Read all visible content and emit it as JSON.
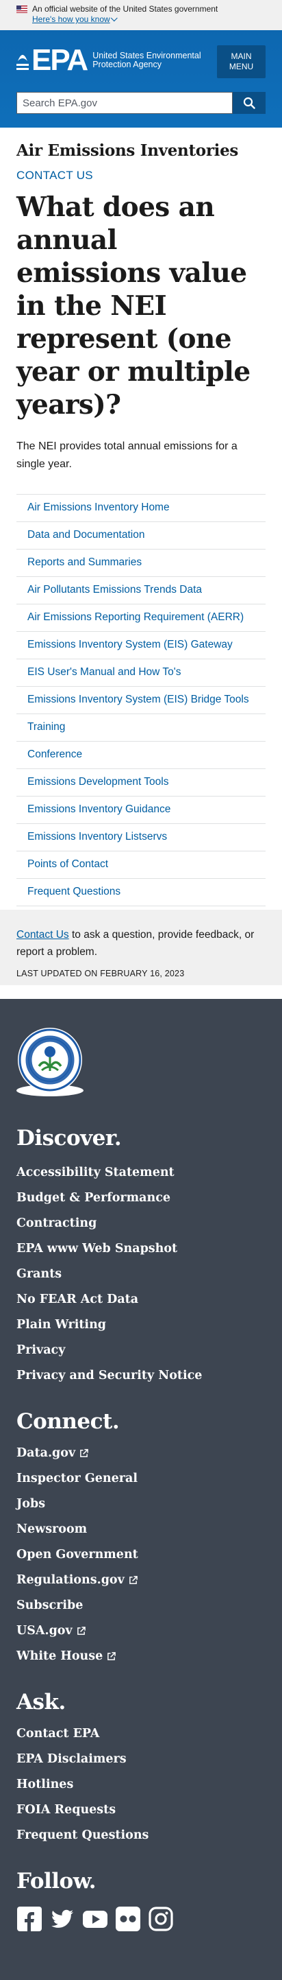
{
  "gov_banner": {
    "text": "An official website of the United States government",
    "how_link": "Here's how you know"
  },
  "header": {
    "logo_mark": "EPA",
    "logo_text": "United States Environmental Protection Agency",
    "menu_line1": "MAIN",
    "menu_line2": "MENU",
    "search_placeholder": "Search EPA.gov"
  },
  "main": {
    "section_title": "Air Emissions Inventories",
    "contact_link": "CONTACT US",
    "page_title": "What does an annual emissions value in the NEI represent (one year or multiple years)?",
    "intro": "The NEI provides total annual emissions for a single year.",
    "sidenav": [
      "Air Emissions Inventory Home",
      "Data and Documentation",
      "Reports and Summaries",
      "Air Pollutants Emissions Trends Data",
      "Air Emissions Reporting Requirement (AERR)",
      "Emissions Inventory System (EIS) Gateway",
      "EIS User's Manual and How To's",
      "Emissions Inventory System (EIS) Bridge Tools",
      "Training",
      "Conference",
      "Emissions Development Tools",
      "Emissions Inventory Guidance",
      "Emissions Inventory Listservs",
      "Points of Contact",
      "Frequent Questions"
    ]
  },
  "contact_strip": {
    "link": "Contact Us",
    "text": " to ask a question, provide feedback, or report a problem.",
    "updated": "LAST UPDATED ON FEBRUARY 16, 2023"
  },
  "footer": {
    "discover_heading": "Discover.",
    "discover": [
      {
        "label": "Accessibility Statement",
        "ext": false
      },
      {
        "label": "Budget & Performance",
        "ext": false
      },
      {
        "label": "Contracting",
        "ext": false
      },
      {
        "label": "EPA www Web Snapshot",
        "ext": false
      },
      {
        "label": "Grants",
        "ext": false
      },
      {
        "label": "No FEAR Act Data",
        "ext": false
      },
      {
        "label": "Plain Writing",
        "ext": false
      },
      {
        "label": "Privacy",
        "ext": false
      },
      {
        "label": "Privacy and Security Notice",
        "ext": false
      }
    ],
    "connect_heading": "Connect.",
    "connect": [
      {
        "label": "Data.gov",
        "ext": true
      },
      {
        "label": "Inspector General",
        "ext": false
      },
      {
        "label": "Jobs",
        "ext": false
      },
      {
        "label": "Newsroom",
        "ext": false
      },
      {
        "label": "Open Government",
        "ext": false
      },
      {
        "label": "Regulations.gov",
        "ext": true
      },
      {
        "label": "Subscribe",
        "ext": false
      },
      {
        "label": "USA.gov",
        "ext": true
      },
      {
        "label": "White House",
        "ext": true
      }
    ],
    "ask_heading": "Ask.",
    "ask": [
      {
        "label": "Contact EPA",
        "ext": false
      },
      {
        "label": "EPA Disclaimers",
        "ext": false
      },
      {
        "label": "Hotlines",
        "ext": false
      },
      {
        "label": "FOIA Requests",
        "ext": false
      },
      {
        "label": "Frequent Questions",
        "ext": false
      }
    ],
    "follow_heading": "Follow.",
    "socials": [
      "facebook-icon",
      "twitter-icon",
      "youtube-icon",
      "flickr-icon",
      "instagram-icon"
    ]
  },
  "colors": {
    "header_blue": "#0e6cb6",
    "link_blue": "#005ea2",
    "footer_bg": "#3d4551",
    "banner_bg": "#f0f0f0"
  }
}
